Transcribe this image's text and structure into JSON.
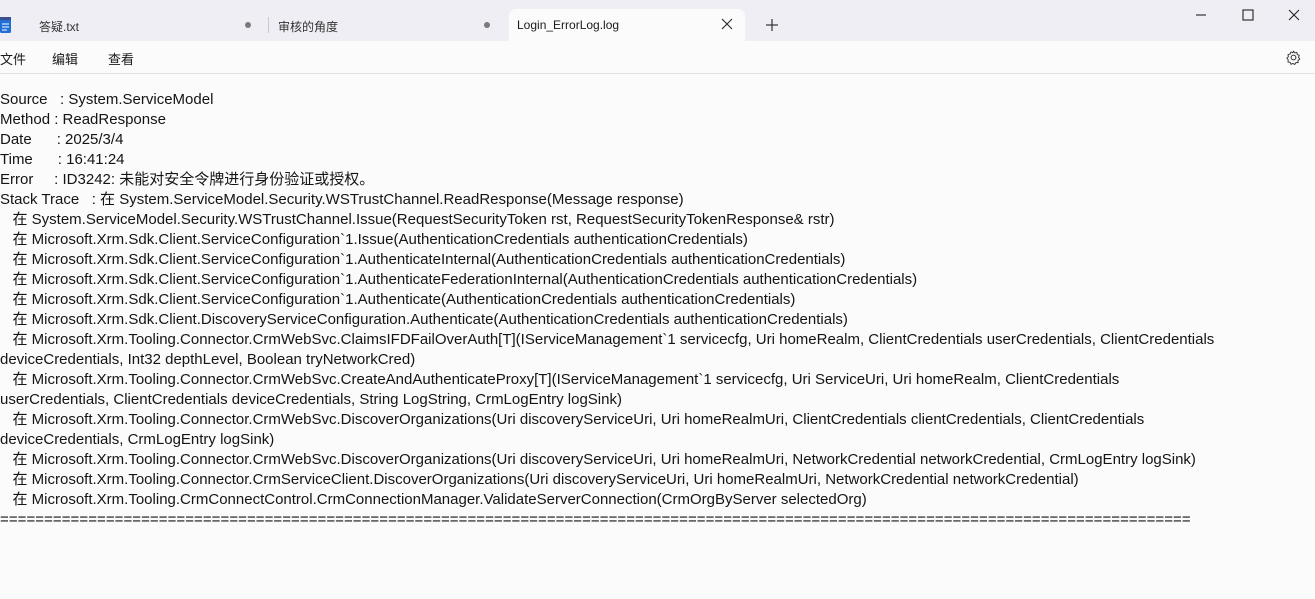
{
  "window": {
    "tabs": [
      {
        "label": "答疑.txt",
        "unsaved": true
      },
      {
        "label": "审核的角度",
        "unsaved": true
      },
      {
        "label": "Login_ErrorLog.log",
        "active": true
      }
    ],
    "new_tab_icon": "plus-icon",
    "controls": [
      "minimize-icon",
      "maximize-icon",
      "close-icon"
    ]
  },
  "menubar": {
    "file": "文件",
    "edit": "编辑",
    "view": "查看",
    "settings_icon": "gear-icon"
  },
  "editor": {
    "lines": [
      "Source   : System.ServiceModel",
      "Method : ReadResponse",
      "Date      : 2025/3/4",
      "Time      : 16:41:24",
      "Error     : ID3242: 未能对安全令牌进行身份验证或授权。",
      "Stack Trace   : 在 System.ServiceModel.Security.WSTrustChannel.ReadResponse(Message response)",
      "   在 System.ServiceModel.Security.WSTrustChannel.Issue(RequestSecurityToken rst, RequestSecurityTokenResponse& rstr)",
      "   在 Microsoft.Xrm.Sdk.Client.ServiceConfiguration`1.Issue(AuthenticationCredentials authenticationCredentials)",
      "   在 Microsoft.Xrm.Sdk.Client.ServiceConfiguration`1.AuthenticateInternal(AuthenticationCredentials authenticationCredentials)",
      "   在 Microsoft.Xrm.Sdk.Client.ServiceConfiguration`1.AuthenticateFederationInternal(AuthenticationCredentials authenticationCredentials)",
      "   在 Microsoft.Xrm.Sdk.Client.ServiceConfiguration`1.Authenticate(AuthenticationCredentials authenticationCredentials)",
      "   在 Microsoft.Xrm.Sdk.Client.DiscoveryServiceConfiguration.Authenticate(AuthenticationCredentials authenticationCredentials)",
      "   在 Microsoft.Xrm.Tooling.Connector.CrmWebSvc.ClaimsIFDFailOverAuth[T](IServiceManagement`1 servicecfg, Uri homeRealm, ClientCredentials userCredentials, ClientCredentials",
      "deviceCredentials, Int32 depthLevel, Boolean tryNetworkCred)",
      "   在 Microsoft.Xrm.Tooling.Connector.CrmWebSvc.CreateAndAuthenticateProxy[T](IServiceManagement`1 servicecfg, Uri ServiceUri, Uri homeRealm, ClientCredentials",
      "userCredentials, ClientCredentials deviceCredentials, String LogString, CrmLogEntry logSink)",
      "   在 Microsoft.Xrm.Tooling.Connector.CrmWebSvc.DiscoverOrganizations(Uri discoveryServiceUri, Uri homeRealmUri, ClientCredentials clientCredentials, ClientCredentials",
      "deviceCredentials, CrmLogEntry logSink)",
      "   在 Microsoft.Xrm.Tooling.Connector.CrmWebSvc.DiscoverOrganizations(Uri discoveryServiceUri, Uri homeRealmUri, NetworkCredential networkCredential, CrmLogEntry logSink)",
      "   在 Microsoft.Xrm.Tooling.Connector.CrmServiceClient.DiscoverOrganizations(Uri discoveryServiceUri, Uri homeRealmUri, NetworkCredential networkCredential)",
      "   在 Microsoft.Xrm.Tooling.CrmConnectControl.CrmConnectionManager.ValidateServerConnection(CrmOrgByServer selectedOrg)",
      "======================================================================================================================================="
    ]
  }
}
